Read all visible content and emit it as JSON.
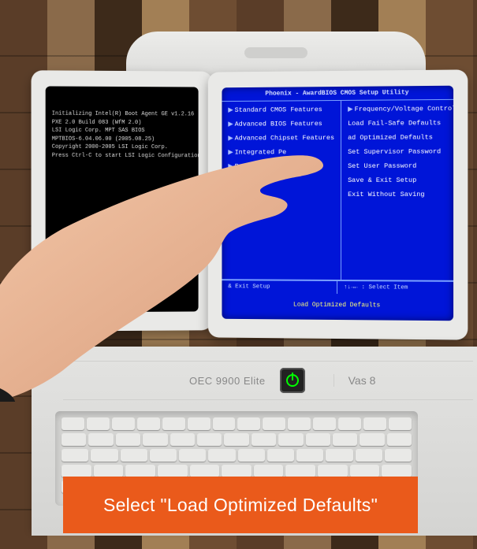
{
  "wall": {},
  "left_screen": {
    "lines": [
      "Initializing Intel(R) Boot Agent GE v1.2.16",
      "PXE 2.0 Build 083 (WfM 2.0)",
      "",
      "LSI Logic Corp. MPT SAS BIOS",
      "MPTBIOS-6.04.06.00 (2005.08.25)",
      "Copyright 2000-2005 LSI Logic Corp.",
      "",
      "Press Ctrl-C to start LSI Logic Configuration Utility..."
    ]
  },
  "bios": {
    "title": "Phoenix - AwardBIOS CMOS Setup Utility",
    "left_items": [
      {
        "arrow": true,
        "label": "Standard CMOS Features"
      },
      {
        "arrow": true,
        "label": "Advanced BIOS Features"
      },
      {
        "arrow": true,
        "label": "Advanced Chipset Features"
      },
      {
        "arrow": true,
        "label": "Integrated Pe"
      },
      {
        "arrow": true,
        "label": "Po"
      },
      {
        "arrow": false,
        "label": ""
      }
    ],
    "right_items": [
      {
        "arrow": true,
        "label": "Frequency/Voltage Control",
        "hl": false
      },
      {
        "arrow": false,
        "label": "Load Fail-Safe Defaults",
        "hl": false
      },
      {
        "arrow": false,
        "label": "ad Optimized Defaults",
        "hl": true
      },
      {
        "arrow": false,
        "label": "Set Supervisor Password",
        "hl": false
      },
      {
        "arrow": false,
        "label": "Set User Password",
        "hl": false
      },
      {
        "arrow": false,
        "label": "Save & Exit Setup",
        "hl": false
      },
      {
        "arrow": false,
        "label": "Exit Without Saving",
        "hl": false
      }
    ],
    "help_left": "& Exit Setup",
    "help_right": "↑↓→← : Select Item",
    "footer": "Load Optimized Defaults"
  },
  "device": {
    "model": "OEC 9900 Elite",
    "vas": "Vas 8"
  },
  "caption": "Select \"Load Optimized Defaults\""
}
